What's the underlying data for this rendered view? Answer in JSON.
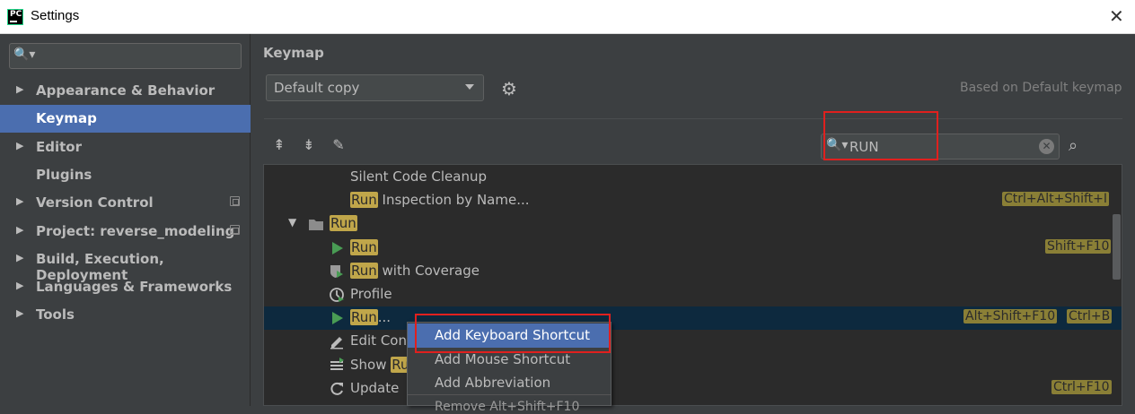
{
  "window": {
    "app_icon_text": "PC",
    "title": "Settings",
    "close": "✕"
  },
  "sidebar": {
    "search_icon": "🔍▾",
    "items": [
      {
        "label": "Appearance & Behavior",
        "expandable": true,
        "arrow": "▶"
      },
      {
        "label": "Keymap",
        "expandable": false,
        "selected": true
      },
      {
        "label": "Editor",
        "expandable": true,
        "arrow": "▶"
      },
      {
        "label": "Plugins",
        "expandable": false
      },
      {
        "label": "Version Control",
        "expandable": true,
        "arrow": "▶",
        "project_icon": true
      },
      {
        "label": "Project: reverse_modeling",
        "expandable": true,
        "arrow": "▶",
        "project_icon": true
      },
      {
        "label": "Build, Execution, Deployment",
        "expandable": true,
        "arrow": "▶"
      },
      {
        "label": "Languages & Frameworks",
        "expandable": true,
        "arrow": "▶"
      },
      {
        "label": "Tools",
        "expandable": true,
        "arrow": "▶"
      }
    ]
  },
  "keymap": {
    "title": "Keymap",
    "scheme_value": "Default copy",
    "based_on": "Based on Default keymap",
    "filter_value": "RUN",
    "filter_icon": "🔍▾",
    "clear_icon": "✕",
    "toolbar": {
      "expand_all": "⇞",
      "collapse_all": "⇟",
      "edit": "✎",
      "find_shortcut": "⌕",
      "gear": "⚙"
    },
    "rows": [
      {
        "prefix": "",
        "hl": "",
        "text": "Silent Code Cleanup",
        "icon": "",
        "shortcuts": []
      },
      {
        "prefix": "",
        "hl": "Run",
        "text": " Inspection by Name...",
        "icon": "",
        "shortcuts": [
          "Ctrl+Alt+Shift+I"
        ]
      },
      {
        "prefix": "",
        "hl": "Run",
        "text": "",
        "icon": "folder",
        "shortcuts": [],
        "group": true
      },
      {
        "prefix": "",
        "hl": "Run",
        "text": "",
        "icon": "run",
        "shortcuts": [
          "Shift+F10"
        ]
      },
      {
        "prefix": "",
        "hl": "Run",
        "text": " with Coverage",
        "icon": "coverage",
        "shortcuts": []
      },
      {
        "prefix": "",
        "hl": "",
        "text": "Profile",
        "icon": "profile",
        "shortcuts": []
      },
      {
        "prefix": "",
        "hl": "Run",
        "text": "...",
        "icon": "run",
        "shortcuts": [
          "Alt+Shift+F10",
          "Ctrl+B"
        ],
        "selected": true
      },
      {
        "prefix": "Edit Con",
        "hl": "",
        "text": "",
        "icon": "edit",
        "shortcuts": []
      },
      {
        "prefix": "Show ",
        "hl": "Ru",
        "text": "",
        "icon": "list",
        "shortcuts": []
      },
      {
        "prefix": "Update ",
        "hl": "",
        "text": "",
        "icon": "update",
        "shortcuts": [
          "Ctrl+F10"
        ]
      }
    ]
  },
  "context_menu": {
    "items": [
      {
        "label": "Add Keyboard Shortcut",
        "active": true
      },
      {
        "label": "Add Mouse Shortcut"
      },
      {
        "label": "Add Abbreviation"
      }
    ],
    "partial": "Remove Alt+Shift+F10"
  },
  "colors": {
    "accent": "#4b6eaf",
    "highlight": "#c0a64a",
    "annotation": "#e0201e"
  }
}
